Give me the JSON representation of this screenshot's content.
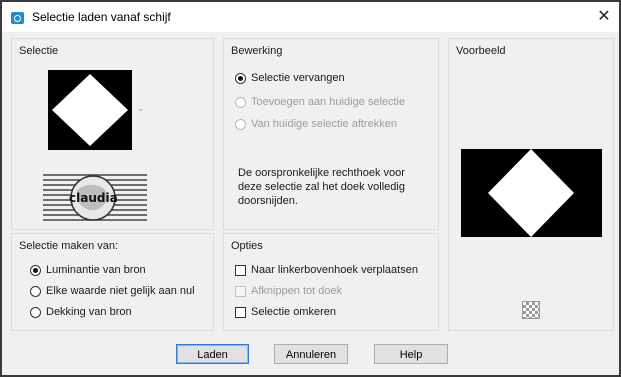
{
  "window": {
    "title": "Selectie laden vanaf schijf",
    "close_glyph": "✕"
  },
  "selectie": {
    "title": "Selectie"
  },
  "bewerking": {
    "title": "Bewerking",
    "options": [
      {
        "label": "Selectie vervangen",
        "checked": true,
        "enabled": true
      },
      {
        "label": "Toevoegen aan huidige selectie",
        "checked": false,
        "enabled": false
      },
      {
        "label": "Van huidige selectie aftrekken",
        "checked": false,
        "enabled": false
      }
    ],
    "info": "De oorspronkelijke rechthoek voor deze selectie zal het doek volledig doorsnijden."
  },
  "voorbeeld": {
    "title": "Voorbeeld"
  },
  "selectie_maken": {
    "title": "Selectie maken van:",
    "options": [
      {
        "label": "Luminantie van bron",
        "checked": true
      },
      {
        "label": "Elke waarde niet gelijk aan nul",
        "checked": false
      },
      {
        "label": "Dekking van bron",
        "checked": false
      }
    ]
  },
  "opties": {
    "title": "Opties",
    "checks": [
      {
        "label": "Naar linkerbovenhoek verplaatsen",
        "checked": false,
        "enabled": true
      },
      {
        "label": "Afknippen tot doek",
        "checked": false,
        "enabled": false
      },
      {
        "label": "Selectie omkeren",
        "checked": false,
        "enabled": true
      }
    ]
  },
  "buttons": {
    "load": "Laden",
    "cancel": "Annuleren",
    "help": "Help"
  },
  "watermark": "claudia",
  "colors": {
    "accent": "#2f7ad6",
    "app_icon": "#1f8fc9"
  }
}
